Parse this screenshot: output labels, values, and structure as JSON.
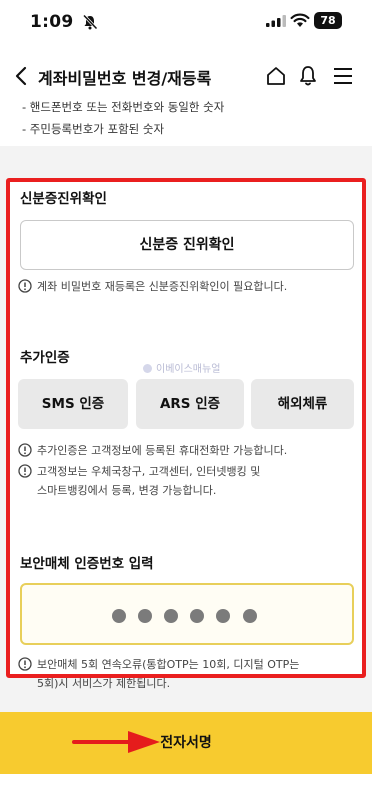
{
  "status_bar": {
    "time": "1:09",
    "battery": "78"
  },
  "header": {
    "title": "계좌비밀번호 변경/재등록"
  },
  "top_notes": [
    "- 핸드폰번호 또는 전화번호와 동일한 숫자",
    "- 주민등록번호가 포함된 숫자"
  ],
  "id_verification": {
    "title": "신분증진위확인",
    "button_label": "신분증 진위확인",
    "notice": "계좌 비밀번호 재등록은 신분증진위확인이 필요합니다."
  },
  "additional_auth": {
    "title": "추가인증",
    "buttons": [
      "SMS 인증",
      "ARS 인증",
      "해외체류"
    ],
    "notices": [
      "추가인증은 고객정보에 등록된 휴대전화만 가능합니다.",
      [
        "고객정보는 우체국창구, 고객센터, 인터넷뱅킹 및",
        "스마트뱅킹에서 등록, 변경 가능합니다."
      ]
    ]
  },
  "watermark": "이베이스매뉴얼",
  "security_media": {
    "title": "보안매체 인증번호 입력",
    "pin_length": 6,
    "notice": [
      "보안매체 5회 연속오류(통합OTP는 10회, 디지털 OTP는",
      "5회)시 서비스가 제한됩니다."
    ]
  },
  "footer": {
    "sign_label": "전자서명"
  },
  "colors": {
    "highlight_red": "#ea1f1f",
    "cta_yellow": "#f7cb2f",
    "pin_border": "#e8cf5a"
  },
  "icons": [
    "bell-slash-icon",
    "signal-icon",
    "wifi-icon",
    "battery-icon",
    "back-icon",
    "home-icon",
    "bell-icon",
    "menu-icon",
    "info-icon",
    "arrow-annotation-icon"
  ]
}
